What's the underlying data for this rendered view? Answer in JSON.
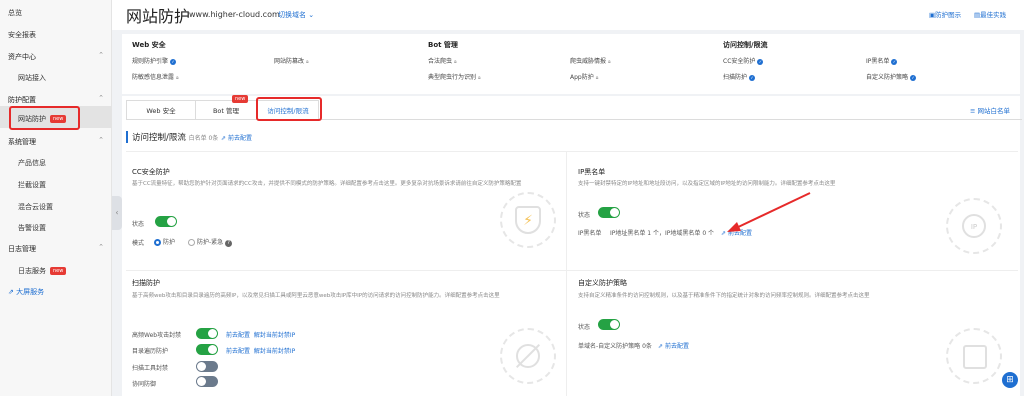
{
  "sidebar": {
    "items": [
      {
        "label": "总览"
      },
      {
        "label": "安全报表"
      },
      {
        "label": "资产中心"
      },
      {
        "label": "网站接入"
      },
      {
        "label": "防护配置"
      },
      {
        "label": "网站防护"
      },
      {
        "label": "系统管理"
      },
      {
        "label": "产品信息"
      },
      {
        "label": "拦截设置"
      },
      {
        "label": "混合云设置"
      },
      {
        "label": "告警设置"
      },
      {
        "label": "日志管理"
      },
      {
        "label": "日志服务"
      },
      {
        "label": "大屏服务"
      }
    ],
    "new_badge": "new"
  },
  "header": {
    "title": "网站防护",
    "domain": "www.higher-cloud.com",
    "switch_domain": "切换域名",
    "link1": "防护图示",
    "link2": "最佳实践"
  },
  "summary": {
    "web": {
      "title": "Web 安全",
      "items": [
        "规则防护引擎",
        "网站防篡改",
        "防敏感信息泄露"
      ]
    },
    "bot": {
      "title": "Bot 管理",
      "items": [
        "合法爬虫",
        "爬虫威胁情报",
        "典型爬虫行为识别",
        "App防护"
      ]
    },
    "acl": {
      "title": "访问控制/限流",
      "items": [
        "CC安全防护",
        "IP黑名单",
        "扫描防护",
        "自定义防护策略"
      ]
    }
  },
  "tabs": [
    "Web 安全",
    "Bot 管理",
    "访问控制/限流"
  ],
  "website_whitelist": "网站白名单",
  "section": {
    "title": "访问控制/限流",
    "whitelist": "白名单 0条",
    "goto": "前去配置"
  },
  "cards": {
    "cc": {
      "title": "CC安全防护",
      "desc": "基于CC流量特征，帮助您防护针对页面请求的CC攻击，并提供不同模式的防护策略。详细配置参考点击这里。更多复杂对抗场景诉求请前往自定义防护策略配置",
      "status_label": "状态",
      "mode_label": "模式",
      "mode_on": "防护",
      "mode_off": "防护-紧急"
    },
    "ipbl": {
      "title": "IP黑名单",
      "desc": "支持一键封禁特定的IP地址和地址段访问，以及指定区域的IP地址的访问限制能力。详细配置参考点击这里",
      "status_label": "状态",
      "info_label": "IP黑名单",
      "info_text": "IP地址黑名单 1 个，IP地域黑名单 0 个",
      "goto": "前去配置"
    },
    "scan": {
      "title": "扫描防护",
      "desc": "基于高频web攻击和目录目录遍历的高频IP，以及常见扫描工具或阿里云恶意web攻击IP库中IP的访问请求的访问控制防护能力。详细配置参考点击这里",
      "rows": [
        {
          "label": "高频Web攻击封禁",
          "goto": "前去配置",
          "unblock": "解封当前封禁IP"
        },
        {
          "label": "目录遍历防护",
          "goto": "前去配置",
          "unblock": "解封当前封禁IP"
        },
        {
          "label": "扫描工具封禁"
        },
        {
          "label": "协同防御"
        }
      ]
    },
    "custom": {
      "title": "自定义防护策略",
      "desc": "支持自定义精准条件的访问控制规则，以及基于精准条件下的指定统计对象的访问频率控制规则。详细配置参考点击这里",
      "status_label": "状态",
      "info_text": "单域名-自定义防护策略 0条",
      "goto": "前去配置"
    }
  }
}
